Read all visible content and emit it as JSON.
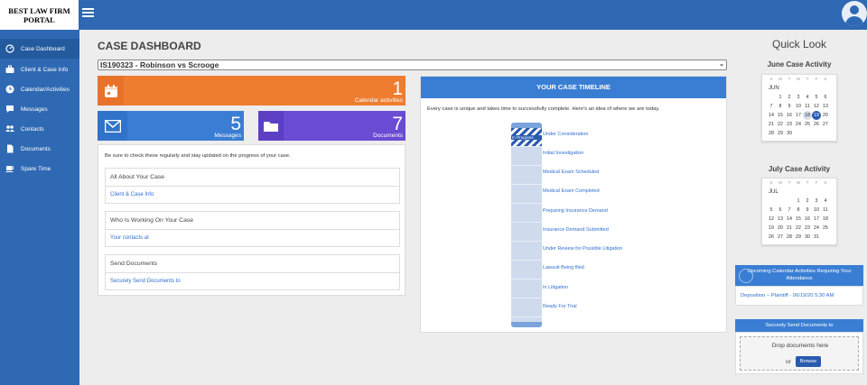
{
  "brand": {
    "line1": "BEST LAW FIRM",
    "line2": "PORTAL"
  },
  "theme": {
    "primary": "#2f69b3",
    "orange": "#ee7d2f",
    "blue": "#3b7dd4",
    "purple": "#6a4bd3"
  },
  "sidebar": {
    "items": [
      {
        "label": "Case Dashboard",
        "icon": "dashboard-icon",
        "active": true
      },
      {
        "label": "Client & Case Info",
        "icon": "briefcase-icon"
      },
      {
        "label": "Calendar/Activities",
        "icon": "clock-icon"
      },
      {
        "label": "Messages",
        "icon": "chat-icon"
      },
      {
        "label": "Contacts",
        "icon": "people-icon"
      },
      {
        "label": "Documents",
        "icon": "document-icon"
      },
      {
        "label": "Spare Time",
        "icon": "coffee-icon"
      }
    ]
  },
  "main": {
    "title": "CASE DASHBOARD",
    "case_selected": "IS190323 - Robinson vs Scrooge",
    "tiles": {
      "calendar": {
        "count": "1",
        "label": "Calendar activities"
      },
      "messages": {
        "count": "5",
        "label": "Messages"
      },
      "documents": {
        "count": "7",
        "label": "Documents"
      }
    },
    "info": {
      "note": "Be sure to check these regularly and stay updated on the progress of your case.",
      "sections": [
        {
          "heading": "All About Your Case",
          "link": "Client & Case Info"
        },
        {
          "heading": "Who Is Working On Your Case",
          "link": "Your contacts at"
        },
        {
          "heading": "Send Documents",
          "link": "Securely Send Documents to"
        }
      ]
    },
    "timeline": {
      "title": "YOUR CASE TIMELINE",
      "intro": "Every case is unique and takes time to successfully complete. Here's an idea of where we are today.",
      "current_label": "In Progress",
      "stages": [
        "Under Consideration",
        "Initial Investigation",
        "Medical Exam Scheduled",
        "Medical Exam Completed",
        "Preparing Insurance Demand",
        "Insurance Demand Submitted",
        "Under Review for Possible Litigation",
        "Lawsuit Being filed",
        "In Litigation",
        "Ready For Trial"
      ]
    }
  },
  "quicklook": {
    "title": "Quick Look",
    "dow": [
      "S",
      "M",
      "T",
      "W",
      "T",
      "F",
      "S"
    ],
    "june": {
      "heading": "June Case Activity",
      "month": "JUN",
      "weeks": [
        [
          "",
          "1",
          "2",
          "3",
          "4",
          "5",
          "6"
        ],
        [
          "7",
          "8",
          "9",
          "10",
          "11",
          "12",
          "13"
        ],
        [
          "14",
          "15",
          "16",
          "17",
          "18",
          "19",
          "20"
        ],
        [
          "21",
          "22",
          "23",
          "24",
          "25",
          "26",
          "27"
        ],
        [
          "28",
          "29",
          "30",
          "",
          "",
          "",
          ""
        ]
      ],
      "selected": "19",
      "today": "18"
    },
    "july": {
      "heading": "July Case Activity",
      "month": "JUL",
      "weeks": [
        [
          "",
          "",
          "",
          "1",
          "2",
          "3",
          "4"
        ],
        [
          "5",
          "6",
          "7",
          "8",
          "9",
          "10",
          "11"
        ],
        [
          "12",
          "13",
          "14",
          "15",
          "16",
          "17",
          "18"
        ],
        [
          "19",
          "20",
          "21",
          "22",
          "23",
          "24",
          "25"
        ],
        [
          "26",
          "27",
          "28",
          "29",
          "30",
          "31",
          ""
        ]
      ]
    },
    "upcoming": {
      "heading": "Upcoming Calendar Activities Requiring Your Attendance",
      "items": [
        "Deposition – Plaintiff - 06/19/20 5:30 AM"
      ]
    },
    "send": {
      "heading": "Securely Send Documents to",
      "drop_text": "Drop documents here",
      "or": "or",
      "browse": "Browse"
    }
  }
}
